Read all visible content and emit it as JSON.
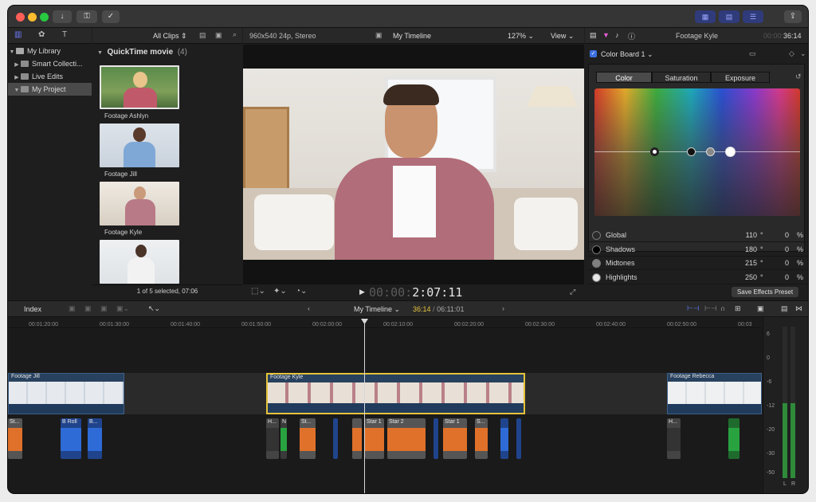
{
  "toolbar": {
    "import_icon": "download-arrow-icon",
    "keywords_icon": "key-icon",
    "check_icon": "checkmark-circle-icon",
    "share_icon": "share-icon"
  },
  "library": {
    "items": [
      {
        "label": "My Library",
        "icon": "library-icon"
      },
      {
        "label": "Smart Collecti...",
        "icon": "folder-icon"
      },
      {
        "label": "Live Edits",
        "icon": "event-icon"
      },
      {
        "label": "My Project",
        "icon": "event-icon"
      }
    ]
  },
  "browser": {
    "filter": "All Clips",
    "group_title": "QuickTime movie",
    "group_count": "(4)",
    "clips": [
      "Footage Ashlyn",
      "Footage Jill",
      "Footage Kyle",
      ""
    ],
    "status": "1 of 5 selected, 07:06"
  },
  "viewer": {
    "format": "960x540 24p, Stereo",
    "title": "My Timeline",
    "zoom": "127%",
    "view": "View",
    "timecode_dim": "00:00:",
    "timecode": "2:07:11"
  },
  "inspector": {
    "clip_name": "Footage Kyle",
    "duration_dim": "00:00:",
    "duration": "36:14",
    "effect_name": "Color Board 1",
    "tabs": [
      "Color",
      "Saturation",
      "Exposure"
    ],
    "rows": [
      {
        "label": "Global",
        "angle": "110",
        "deg": "°",
        "pct": "0",
        "unit": "%"
      },
      {
        "label": "Shadows",
        "angle": "180",
        "deg": "°",
        "pct": "0",
        "unit": "%"
      },
      {
        "label": "Midtones",
        "angle": "215",
        "deg": "°",
        "pct": "0",
        "unit": "%"
      },
      {
        "label": "Highlights",
        "angle": "250",
        "deg": "°",
        "pct": "0",
        "unit": "%"
      }
    ],
    "save_preset": "Save Effects Preset"
  },
  "timeline": {
    "index": "Index",
    "name": "My Timeline",
    "position": "36:14",
    "sep": "/",
    "total": "06:11:01",
    "ruler": [
      "00:01:20:00",
      "00:01:30:00",
      "00:01:40:00",
      "00:01:50:00",
      "00:02:00:00",
      "00:02:10:00",
      "00:02:20:00",
      "00:02:30:00",
      "00:02:40:00",
      "00:02:50:00",
      "00:03"
    ],
    "clips": [
      "Footage Jill",
      "Footage Kyle",
      "Footage Rebecca"
    ],
    "titles": [
      "St...",
      "N",
      "B Roll",
      "B...",
      "H...",
      "St...",
      "Star 1",
      "Star 2",
      "Star 1",
      "S...",
      "H..."
    ]
  },
  "meter": {
    "scale": [
      "6",
      "0",
      "-6",
      "-12",
      "-20",
      "-30",
      "-50"
    ],
    "channels": [
      "L",
      "R"
    ]
  },
  "colors": {
    "accent": "#e5c23a",
    "clip_blue": "#2d4a6e",
    "title_orange": "#e0712a",
    "title_blue": "#2e6bd6",
    "title_green": "#28a340"
  }
}
